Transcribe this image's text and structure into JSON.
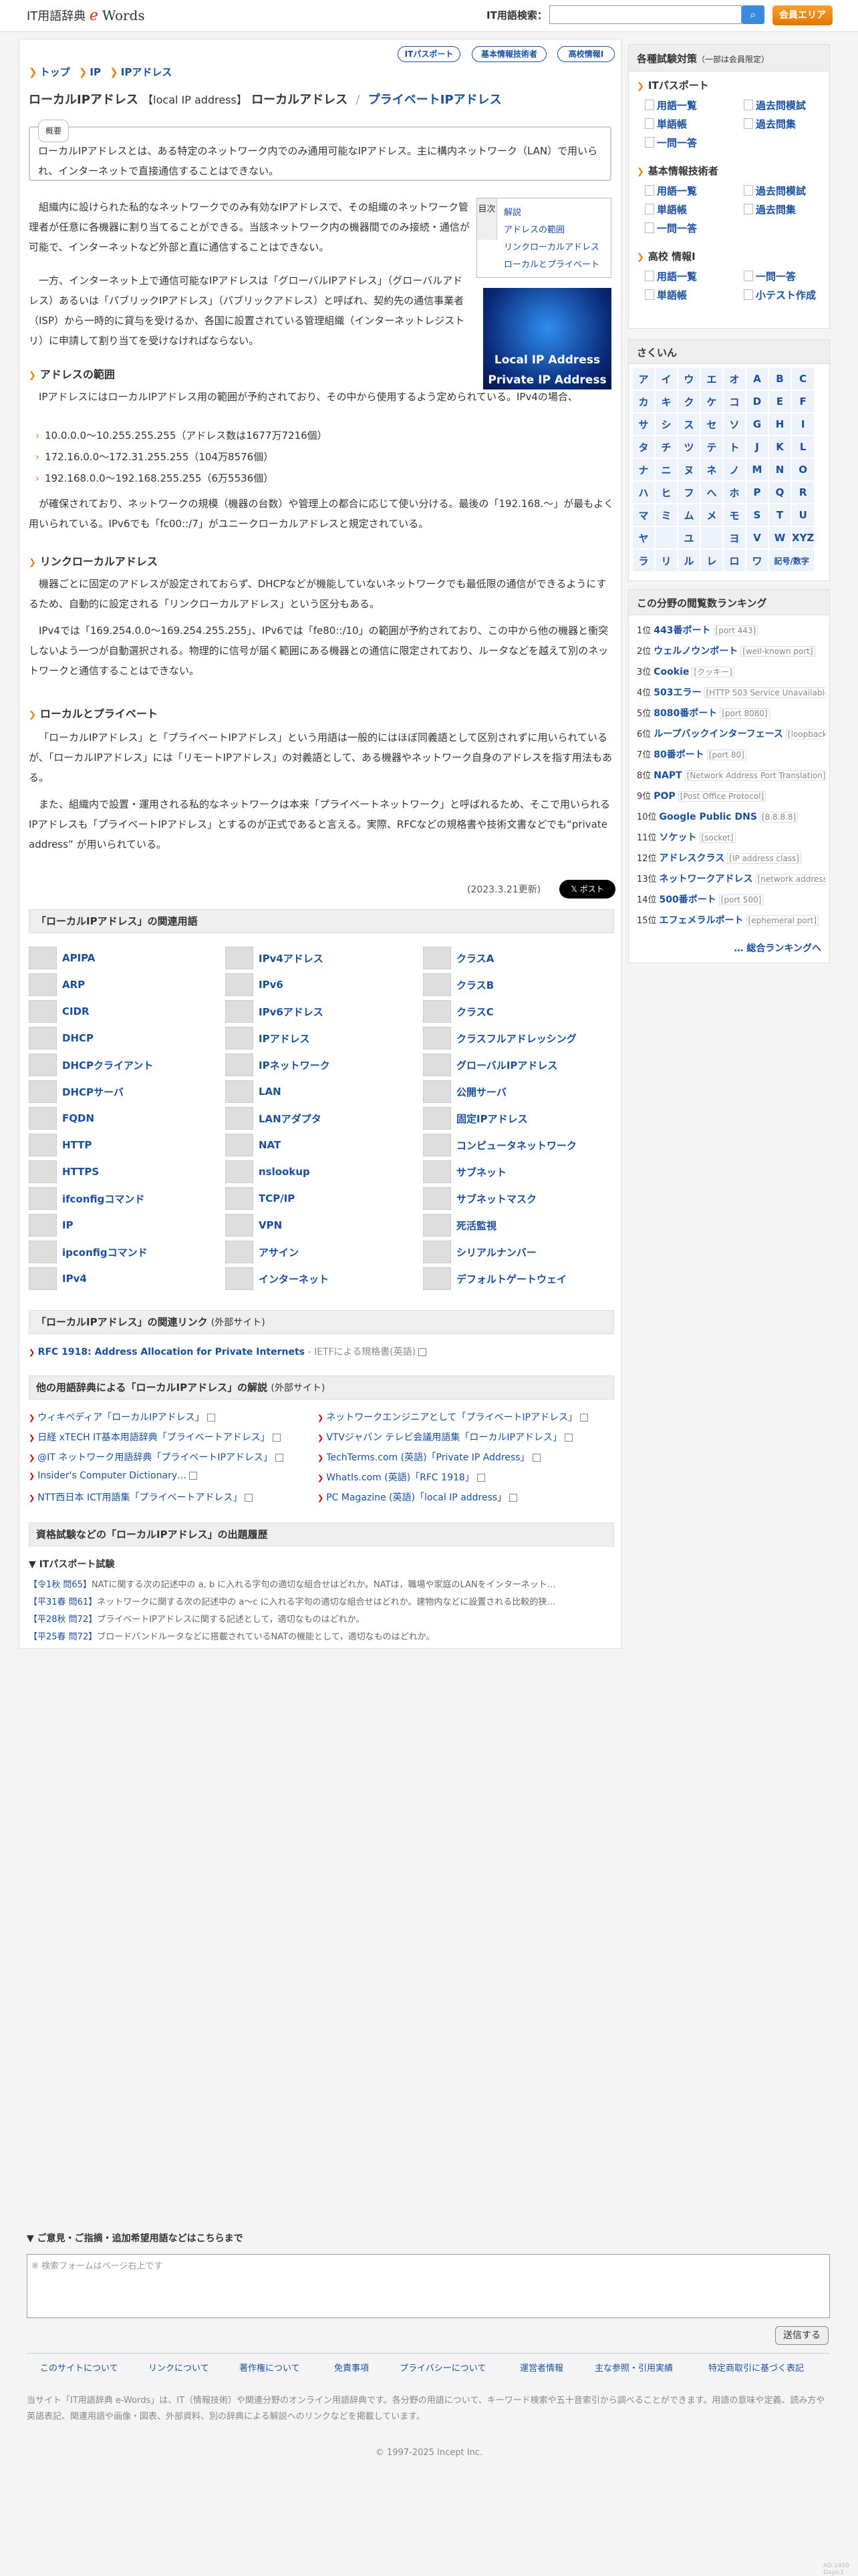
{
  "header": {
    "logo_prefix": "IT用語辞典",
    "logo_e": "e",
    "logo_words": "Words",
    "search_label": "IT用語検索：",
    "search_icon": "search-icon",
    "member_button": "会員エリア"
  },
  "pills": [
    "ITパスポート",
    "基本情報技術者",
    "高校情報Ⅰ"
  ],
  "breadcrumb": [
    "トップ",
    "IP",
    "IPアドレス"
  ],
  "title": {
    "main": "ローカルIPアドレス",
    "reading": "【local IP address】",
    "synonym": "ローカルアドレス",
    "sep": "/",
    "related": "プライベートIPアドレス"
  },
  "gaiyo": {
    "label": "概要",
    "text": "ローカルIPアドレスとは、ある特定のネットワーク内でのみ通用可能なIPアドレス。主に構内ネットワーク（LAN）で用いられ、インターネットで直接通信することはできない。"
  },
  "toc": {
    "label": "目次",
    "items": [
      "解説",
      "アドレスの範囲",
      "リンクローカルアドレス",
      "ローカルとプライベート"
    ]
  },
  "thumb": {
    "line1": "Local IP Address",
    "line2": "Private IP Address"
  },
  "paragraphs": {
    "p1": "組織内に設けられた私的なネットワークでのみ有効なIPアドレスで、その組織のネットワーク管理者が任意に各機器に割り当てることができる。当該ネットワーク内の機器間でのみ接続・通信が可能で、インターネットなど外部と直に通信することはできない。",
    "p2": "一方、インターネット上で通信可能なIPアドレスは「グローバルIPアドレス」（グローバルアドレス）あるいは「パブリックIPアドレス」（パブリックアドレス）と呼ばれ、契約先の通信事業者（ISP）から一時的に貸与を受けるか、各国に設置されている管理組織（インターネットレジストリ）に申請して割り当てを受けなければならない。",
    "h_range": "アドレスの範囲",
    "p3": "IPアドレスにはローカルIPアドレス用の範囲が予約されており、その中から使用するよう定められている。IPv4の場合、",
    "ranges": [
      "10.0.0.0〜10.255.255.255（アドレス数は1677万7216個）",
      "172.16.0.0〜172.31.255.255（104万8576個）",
      "192.168.0.0〜192.168.255.255（6万5536個）"
    ],
    "p4": "が確保されており、ネットワークの規模（機器の台数）や管理上の都合に応じて使い分ける。最後の「192.168.〜」が最もよく用いられている。IPv6でも「fc00::/7」がユニークローカルアドレスと規定されている。",
    "h_link": "リンクローカルアドレス",
    "p5": "機器ごとに固定のアドレスが設定されておらず、DHCPなどが機能していないネットワークでも最低限の通信ができるようにするため、自動的に設定される「リンクローカルアドレス」という区分もある。",
    "p6": "IPv4では「169.254.0.0〜169.254.255.255」、IPv6では「fe80::/10」の範囲が予約されており、この中から他の機器と衝突しないよう一つが自動選択される。物理的に信号が届く範囲にある機器との通信に限定されており、ルータなどを越えて別のネットワークと通信することはできない。",
    "h_lp": "ローカルとプライベート",
    "p7": "「ローカルIPアドレス」と「プライベートIPアドレス」という用語は一般的にはほぼ同義語として区別されずに用いられているが、「ローカルIPアドレス」には「リモートIPアドレス」の対義語として、ある機器やネットワーク自身のアドレスを指す用法もある。",
    "p8": "また、組織内で設置・運用される私的なネットワークは本来「プライベートネットワーク」と呼ばれるため、そこで用いられるIPアドレスも「プライベートIPアドレス」とするのが正式であると言える。実際、RFCなどの規格書や技術文書などでも“private address” が用いられている。"
  },
  "date": "(2023.3.21更新)",
  "post_button": "𝕏 ポスト",
  "related_title": "「ローカルIPアドレス」の関連用語",
  "related_cols": [
    [
      "APIPA",
      "ARP",
      "CIDR",
      "DHCP",
      "DHCPクライアント",
      "DHCPサーバ",
      "FQDN",
      "HTTP",
      "HTTPS",
      "ifconfigコマンド",
      "IP",
      "ipconfigコマンド",
      "IPv4"
    ],
    [
      "IPv4アドレス",
      "IPv6",
      "IPv6アドレス",
      "IPアドレス",
      "IPネットワーク",
      "LAN",
      "LANアダプタ",
      "NAT",
      "nslookup",
      "TCP/IP",
      "VPN",
      "アサイン",
      "インターネット"
    ],
    [
      "クラスA",
      "クラスB",
      "クラスC",
      "クラスフルアドレッシング",
      "グローバルIPアドレス",
      "公開サーバ",
      "固定IPアドレス",
      "コンピュータネットワーク",
      "サブネット",
      "サブネットマスク",
      "死活監視",
      "シリアルナンバー",
      "デフォルトゲートウェイ"
    ]
  ],
  "links_title": "「ローカルIPアドレス」の関連リンク",
  "links_ext": "(外部サイト)",
  "links": [
    {
      "text": "RFC 1918: Address Allocation for Private Internets",
      "note": "- IETFによる規格書(英語)"
    }
  ],
  "other_title": "他の用語辞典による「ローカルIPアドレス」の解説",
  "other_ext": "(外部サイト)",
  "other_left": [
    "ウィキペディア「ローカルIPアドレス」",
    "日経 xTECH IT基本用語辞典「プライベートアドレス」",
    "@IT ネットワーク用語辞典「プライベートIPアドレス」",
    "Insider's Computer Dictionary…",
    "NTT西日本 ICT用語集「プライベートアドレス」"
  ],
  "other_right": [
    "ネットワークエンジニアとして「プライベートIPアドレス」",
    "VTVジャパン テレビ会議用語集「ローカルIPアドレス」",
    "TechTerms.com (英語)「Private IP Address」",
    "WhatIs.com (英語)「RFC 1918」",
    "PC Magazine (英語)「local IP address」"
  ],
  "exam_title": "資格試験などの「ローカルIPアドレス」の出題履歴",
  "exam_cat": "▼ ITパスポート試験",
  "exams": [
    {
      "tag": "【令1秋 問65】",
      "text": "NATに関する次の記述中の a, b に入れる字句の適切な組合せはどれか。NATは，職場や家庭のLANをインターネット…"
    },
    {
      "tag": "【平31春 問61】",
      "text": "ネットワークに関する次の記述中の a〜c に入れる字句の適切な組合せはどれか。建物内などに設置される比較的狭…"
    },
    {
      "tag": "【平28秋 問72】",
      "text": "プライベートIPアドレスに関する記述として，適切なものはどれか。"
    },
    {
      "tag": "【平25春 問72】",
      "text": "ブロードバンドルータなどに搭載されているNATの機能として，適切なものはどれか。"
    }
  ],
  "side": {
    "title": "各種試験対策",
    "title_note": "（一部は会員限定）",
    "groups": [
      {
        "name": "ITパスポート",
        "items": [
          "用語一覧",
          "過去問模試",
          "単語帳",
          "過去問集",
          "一問一答"
        ]
      },
      {
        "name": "基本情報技術者",
        "items": [
          "用語一覧",
          "過去問模試",
          "単語帳",
          "過去問集",
          "一問一答"
        ]
      },
      {
        "name": "高校 情報Ⅰ",
        "items": [
          "用語一覧",
          "一問一答",
          "単語帳",
          "小テスト作成"
        ]
      }
    ],
    "sakuin": "さくいん",
    "kana": [
      [
        "ア",
        "イ",
        "ウ",
        "エ",
        "オ",
        "A",
        "B",
        "C"
      ],
      [
        "カ",
        "キ",
        "ク",
        "ケ",
        "コ",
        "D",
        "E",
        "F"
      ],
      [
        "サ",
        "シ",
        "ス",
        "セ",
        "ソ",
        "G",
        "H",
        "I"
      ],
      [
        "タ",
        "チ",
        "ツ",
        "テ",
        "ト",
        "J",
        "K",
        "L"
      ],
      [
        "ナ",
        "ニ",
        "ヌ",
        "ネ",
        "ノ",
        "M",
        "N",
        "O"
      ],
      [
        "ハ",
        "ヒ",
        "フ",
        "ヘ",
        "ホ",
        "P",
        "Q",
        "R"
      ],
      [
        "マ",
        "ミ",
        "ム",
        "メ",
        "モ",
        "S",
        "T",
        "U"
      ],
      [
        "ヤ",
        "",
        "ユ",
        "",
        "ヨ",
        "V",
        "W",
        "XYZ"
      ],
      [
        "ラ",
        "リ",
        "ル",
        "レ",
        "ロ",
        "ワ",
        "記号/数字",
        ""
      ]
    ],
    "ranking_title": "この分野の閲覧数ランキング",
    "ranking": [
      {
        "no": "1位",
        "name": "443番ポート",
        "sub": "[port 443]"
      },
      {
        "no": "2位",
        "name": "ウェルノウンポート",
        "sub": "[well-known port]"
      },
      {
        "no": "3位",
        "name": "Cookie",
        "sub": "[クッキー]"
      },
      {
        "no": "4位",
        "name": "503エラー",
        "sub": "[HTTP 503 Service Unavailable]"
      },
      {
        "no": "5位",
        "name": "8080番ポート",
        "sub": "[port 8080]"
      },
      {
        "no": "6位",
        "name": "ループバックインターフェース",
        "sub": "[loopback interface]"
      },
      {
        "no": "7位",
        "name": "80番ポート",
        "sub": "[port 80]"
      },
      {
        "no": "8位",
        "name": "NAPT",
        "sub": "[Network Address Port Translation]"
      },
      {
        "no": "9位",
        "name": "POP",
        "sub": "[Post Office Protocol]"
      },
      {
        "no": "10位",
        "name": "Google Public DNS",
        "sub": "[8.8.8.8]"
      },
      {
        "no": "11位",
        "name": "ソケット",
        "sub": "[socket]"
      },
      {
        "no": "12位",
        "name": "アドレスクラス",
        "sub": "[IP address class]"
      },
      {
        "no": "13位",
        "name": "ネットワークアドレス",
        "sub": "[network address]"
      },
      {
        "no": "14位",
        "name": "500番ポート",
        "sub": "[port 500]"
      },
      {
        "no": "15位",
        "name": "エフェメラルポート",
        "sub": "[ephemeral port]"
      }
    ],
    "ranking_more": "… 総合ランキングへ"
  },
  "feedback": {
    "title": "▼ ご意見・ご指摘・追加希望用語などはこちらまで",
    "placeholder": "※ 検索フォームはページ右上です",
    "send": "送信する"
  },
  "footer_links": [
    "このサイトについて",
    "リンクについて",
    "著作権について",
    "免責事項",
    "プライバシーについて",
    "運営者情報",
    "主な参照・引用実績",
    "特定商取引に基づく表記"
  ],
  "footer_note": "当サイト「IT用語辞典 e-Words」は、IT（情報技術）や関連分野のオンライン用語辞典です。各分野の用語について、キーワード検索や五十音索引から調べることができます。用語の意味や定義、読み方や英語表記、関連用語や画像・図表、外部資料、別の辞典による解説へのリンクなどを掲載しています。",
  "copyright": "© 1997-2025 Incept Inc.",
  "tiny": "AD:1400 Days:1"
}
